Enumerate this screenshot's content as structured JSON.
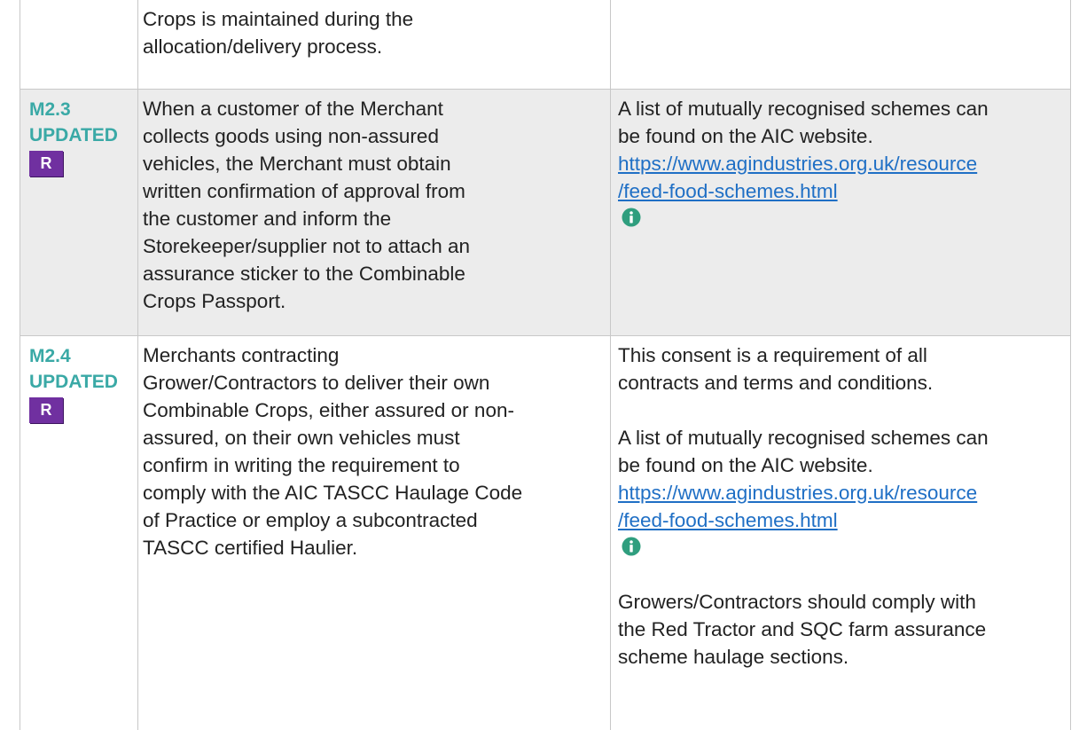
{
  "rows": [
    {
      "ref": "",
      "status": "",
      "badge": "",
      "requirement": "Crops is maintained during the\nallocation/delivery process.",
      "guidance": {}
    },
    {
      "ref": "M2.3",
      "status": "UPDATED",
      "badge": "R",
      "requirement": "When a customer of the Merchant\ncollects goods using non-assured\nvehicles, the Merchant must obtain\nwritten confirmation of approval from\nthe customer and inform the\nStorekeeper/supplier not to attach an\nassurance sticker to the Combinable\nCrops Passport.",
      "guidance": {
        "intro": "A list of mutually recognised schemes can\nbe found on the AIC website.",
        "link_line1": "https://www.agindustries.org.uk/resource",
        "link_line2": "/feed-food-schemes.html",
        "icon": "info-icon"
      }
    },
    {
      "ref": "M2.4",
      "status": "UPDATED",
      "badge": "R",
      "requirement": "Merchants contracting\nGrower/Contractors to deliver their own\nCombinable Crops, either assured or non-\nassured, on their own vehicles must\nconfirm in writing the requirement to\ncomply with the AIC TASCC Haulage Code\nof Practice or employ a subcontracted\nTASCC certified Haulier.",
      "guidance": {
        "consent": "This consent is a requirement of all\ncontracts and terms and conditions.",
        "intro": "A list of mutually recognised schemes can\nbe found on the AIC website.",
        "link_line1": "https://www.agindustries.org.uk/resource",
        "link_line2": "/feed-food-schemes.html",
        "icon": "info-icon",
        "growers": "Growers/Contractors should comply with\nthe Red Tractor and SQC farm assurance\nscheme haulage sections."
      }
    }
  ],
  "colors": {
    "ref_text": "#3aa9a6",
    "badge_bg": "#7030a0",
    "link": "#1f6fc5",
    "info_icon": "#2f9e7e",
    "grey_row": "#ececec"
  }
}
